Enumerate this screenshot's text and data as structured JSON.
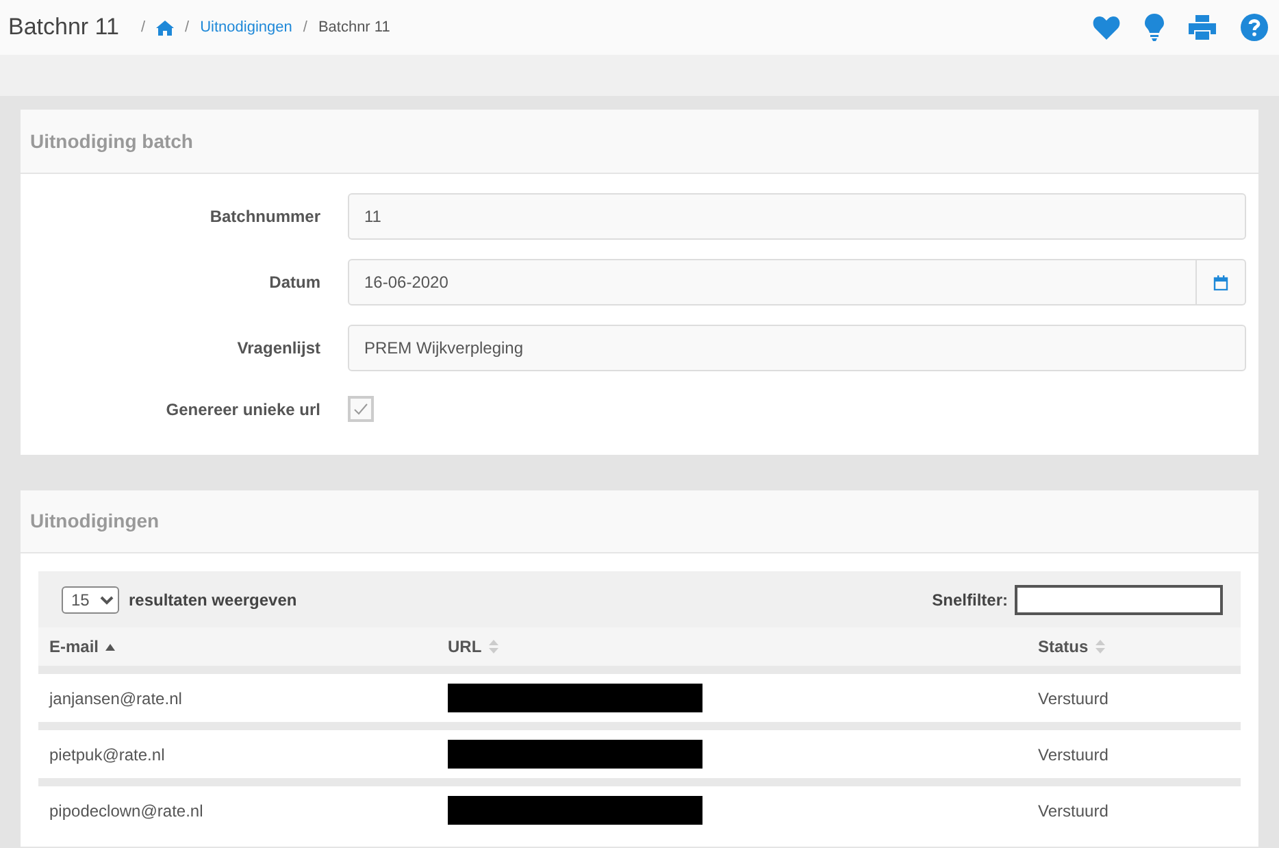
{
  "page_title": "Batchnr 11",
  "breadcrumb": [
    {
      "kind": "home",
      "separator": "/"
    },
    {
      "kind": "link",
      "separator": "/",
      "label": "Uitnodigingen"
    },
    {
      "kind": "current",
      "separator": "/",
      "label": "Batchnr 11"
    }
  ],
  "batch_panel": {
    "title": "Uitnodiging batch",
    "fields": [
      {
        "kind": "text",
        "label": "Batchnummer",
        "value": "11"
      },
      {
        "kind": "date",
        "label": "Datum",
        "value": "16-06-2020"
      },
      {
        "kind": "text",
        "label": "Vragenlijst",
        "value": "PREM Wijkverpleging"
      },
      {
        "kind": "checkbox",
        "label": "Genereer unieke url",
        "checked": true
      }
    ]
  },
  "invitations_panel": {
    "title": "Uitnodigingen",
    "page_size": "15",
    "page_size_label": "resultaten weergeven",
    "filter_label": "Snelfilter:",
    "columns": [
      {
        "label": "E-mail",
        "sorted_ascending": true
      },
      {
        "label": "URL",
        "sorted_ascending": false
      },
      {
        "label": "Status",
        "sorted_ascending": false
      }
    ],
    "rows": [
      {
        "email": "janjansen@rate.nl",
        "url_redacted": true,
        "status": "Verstuurd"
      },
      {
        "email": "pietpuk@rate.nl",
        "url_redacted": true,
        "status": "Verstuurd"
      },
      {
        "email": "pipodeclown@rate.nl",
        "url_redacted": true,
        "status": "Verstuurd"
      }
    ]
  }
}
